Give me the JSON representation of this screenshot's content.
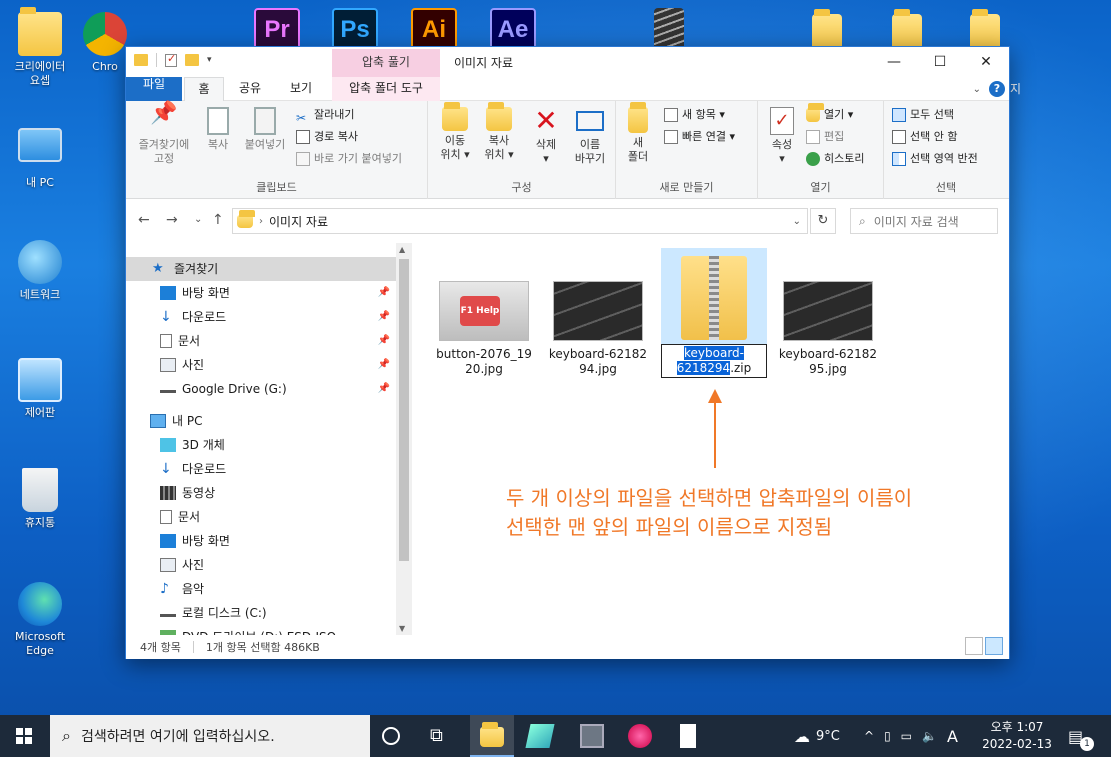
{
  "desktop": {
    "icons": [
      {
        "label": "크리에이터\n요셉"
      },
      {
        "label": "Chro"
      },
      {
        "label": "내 PC"
      },
      {
        "label": "네트워크"
      },
      {
        "label": "제어판"
      },
      {
        "label": "휴지통"
      },
      {
        "label": "Microsoft\nEdge"
      }
    ],
    "apps": [
      "Pr",
      "Ps",
      "Ai",
      "Ae"
    ],
    "right_edge_text": "지"
  },
  "window": {
    "title": "이미지 자료",
    "context_tab_header": "압축 풀기",
    "controls": {
      "minimize": "—",
      "maximize": "☐",
      "close": "✕"
    },
    "tabs": [
      "파일",
      "홈",
      "공유",
      "보기",
      "압축 폴더 도구"
    ],
    "help": "?"
  },
  "ribbon": {
    "clipboard": {
      "group_label": "클립보드",
      "pin": "즐겨찾기에\n고정",
      "copy": "복사",
      "paste": "붙여넣기",
      "cut": "잘라내기",
      "copy_path": "경로 복사",
      "paste_shortcut": "바로 가기 붙여넣기"
    },
    "organize": {
      "group_label": "구성",
      "move": "이동\n위치 ▾",
      "copy_to": "복사\n위치 ▾",
      "delete": "삭제\n▾",
      "rename": "이름\n바꾸기"
    },
    "new": {
      "group_label": "새로 만들기",
      "new_folder": "새\n폴더",
      "new_item": "새 항목 ▾",
      "easy_access": "빠른 연결 ▾"
    },
    "open": {
      "group_label": "열기",
      "properties": "속성\n▾",
      "open": "열기 ▾",
      "edit": "편집",
      "history": "히스토리"
    },
    "select": {
      "group_label": "선택",
      "select_all": "모두 선택",
      "select_none": "선택 안 함",
      "invert": "선택 영역 반전"
    }
  },
  "address": {
    "path": "이미지 자료",
    "search_placeholder": "이미지 자료 검색"
  },
  "navpane": {
    "items": [
      {
        "label": "즐겨찾기",
        "pinned": false
      },
      {
        "label": "바탕 화면",
        "pinned": true
      },
      {
        "label": "다운로드",
        "pinned": true
      },
      {
        "label": "문서",
        "pinned": true
      },
      {
        "label": "사진",
        "pinned": true
      },
      {
        "label": "Google Drive (G:)",
        "pinned": true
      },
      {
        "label": "내 PC",
        "pinned": false
      },
      {
        "label": "3D 개체",
        "pinned": false
      },
      {
        "label": "다운로드",
        "pinned": false
      },
      {
        "label": "동영상",
        "pinned": false
      },
      {
        "label": "문서",
        "pinned": false
      },
      {
        "label": "바탕 화면",
        "pinned": false
      },
      {
        "label": "사진",
        "pinned": false
      },
      {
        "label": "음악",
        "pinned": false
      },
      {
        "label": "로컬 디스크 (C:)",
        "pinned": false
      },
      {
        "label": "DVD 드라이브 (D:) ESD-ISO",
        "pinned": false
      }
    ]
  },
  "files": [
    {
      "name": "button-2076_19\n20.jpg"
    },
    {
      "name": "keyboard-62182\n94.jpg"
    },
    {
      "name_selected_part": "keyboard-\n6218294",
      "name_rest": ".zip"
    },
    {
      "name": "keyboard-62182\n95.jpg"
    }
  ],
  "annotation": {
    "line1": "두 개 이상의 파일을 선택하면 압축파일의 이름이",
    "line2": "선택한 맨 앞의 파일의 이름으로 지정됨",
    "color": "#f07828"
  },
  "status": {
    "count": "4개 항목",
    "selected": "1개 항목 선택함 486KB"
  },
  "taskbar": {
    "search_placeholder": "검색하려면 여기에 입력하십시오.",
    "weather": "9°C",
    "ime": "A",
    "clock_time": "오후 1:07",
    "clock_date": "2022-02-13",
    "notif_count": "1"
  }
}
